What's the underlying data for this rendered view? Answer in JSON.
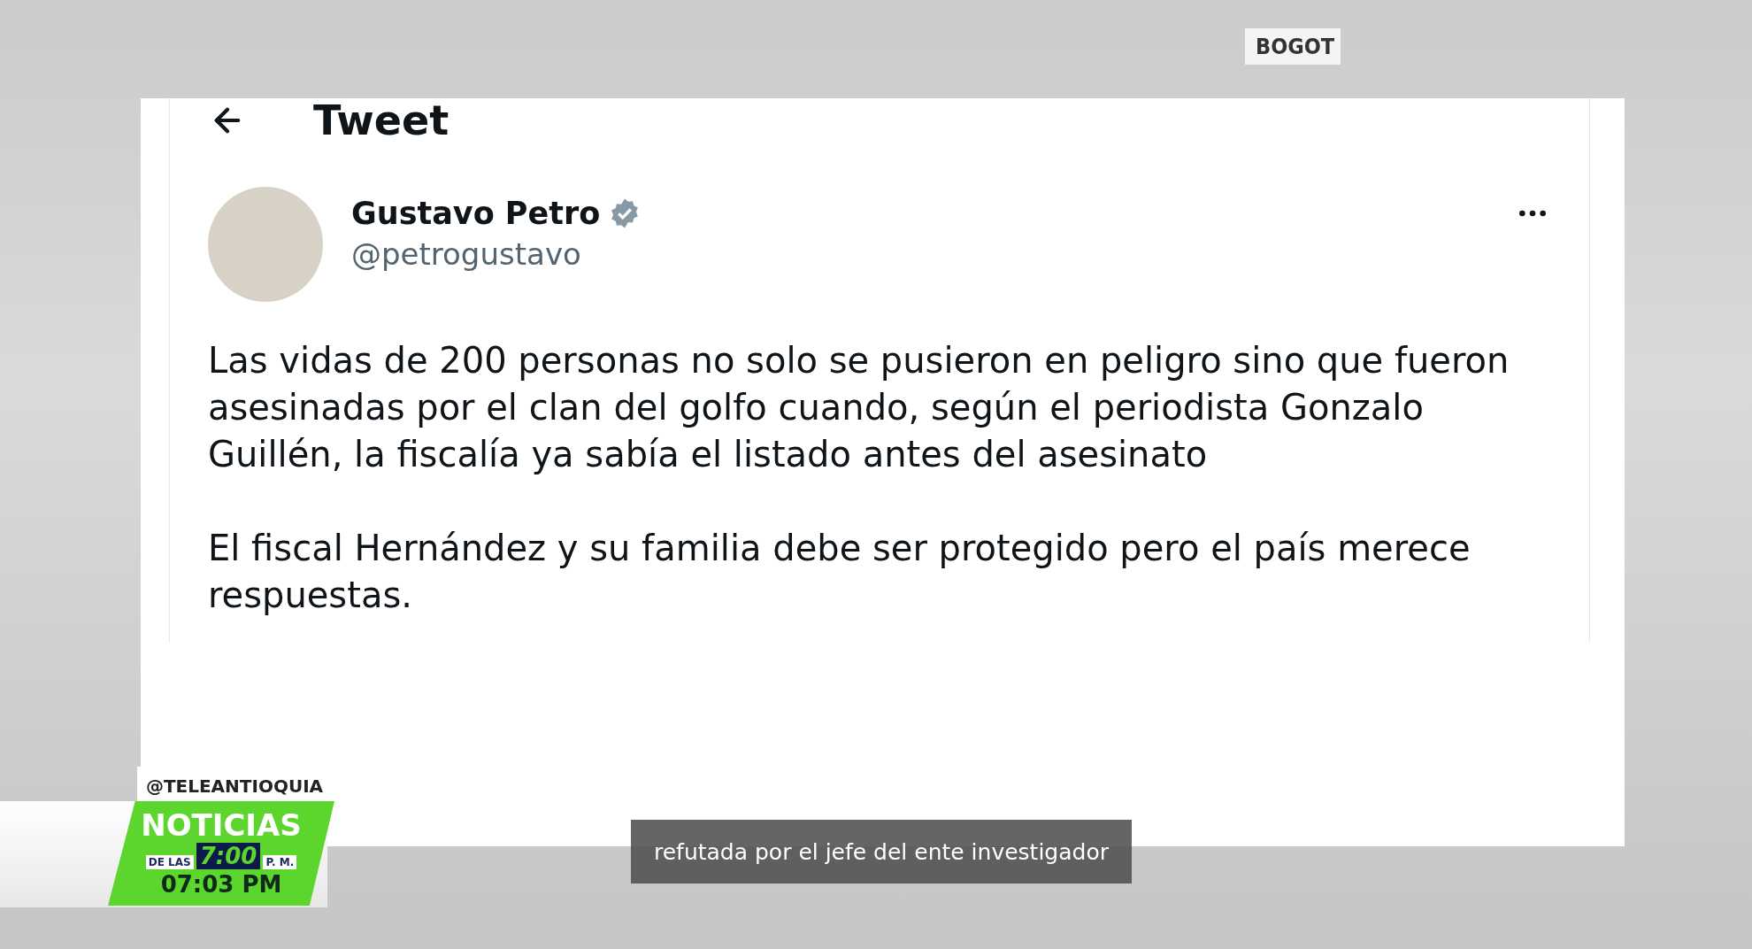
{
  "broadcast": {
    "location_tag": "BOGOT",
    "channel_handle": "@TELEANTIOQUIA",
    "show_title": "NOTICIAS",
    "show_prefix": "DE LAS",
    "show_time": "7:00",
    "show_suffix": "P. M.",
    "clock": "07:03 PM",
    "subtitle": "refutada por el jefe del ente investigador"
  },
  "tweet": {
    "header_title": "Tweet",
    "author_name": "Gustavo Petro",
    "verified": true,
    "handle": "@petrogustavo",
    "paragraphs": [
      "Las vidas de 200 personas no solo se pusieron en peligro sino que fueron asesinadas por el clan del golfo cuando, según el periodista Gonzalo Guillén, la fiscalía ya sabía el listado antes del asesinato",
      "El fiscal Hernández y su familia debe ser protegido pero el país merece respuestas."
    ]
  }
}
